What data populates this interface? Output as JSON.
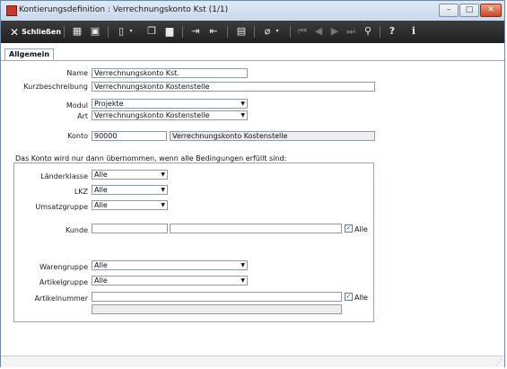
{
  "window": {
    "title": "Kontierungsdefinition : Verrechnungskonto Kst (1/1)"
  },
  "toolbar": {
    "close_label": "Schließen"
  },
  "tabs": [
    {
      "label": "Allgemein"
    }
  ],
  "form": {
    "name": {
      "label": "Name",
      "value": "Verrechnungskonto Kst."
    },
    "kurzbeschreibung": {
      "label": "Kurzbeschreibung",
      "value": "Verrechnungskonto Kostenstelle"
    },
    "modul": {
      "label": "Modul",
      "value": "Projekte"
    },
    "art": {
      "label": "Art",
      "value": "Verrechnungskonto Kostenstelle"
    },
    "konto": {
      "label": "Konto",
      "number": "90000",
      "description": "Verrechnungskonto Kostenstelle"
    }
  },
  "conditions": {
    "caption": "Das Konto wird nur dann übernommen, wenn alle Bedingungen erfüllt sind:",
    "laenderklasse": {
      "label": "Länderklasse",
      "value": "Alle"
    },
    "lkz": {
      "label": "LKZ",
      "value": "Alle"
    },
    "umsatzgruppe": {
      "label": "Umsatzgruppe",
      "value": "Alle"
    },
    "kunde": {
      "label": "Kunde",
      "value": "",
      "value2": "",
      "checkbox_label": "Alle",
      "checked": true
    },
    "warengruppe": {
      "label": "Warengruppe",
      "value": "Alle"
    },
    "artikelgruppe": {
      "label": "Artikelgruppe",
      "value": "Alle"
    },
    "artikelnummer": {
      "label": "Artikelnummer",
      "value": "",
      "value2": "",
      "checkbox_label": "Alle",
      "checked": true
    }
  }
}
